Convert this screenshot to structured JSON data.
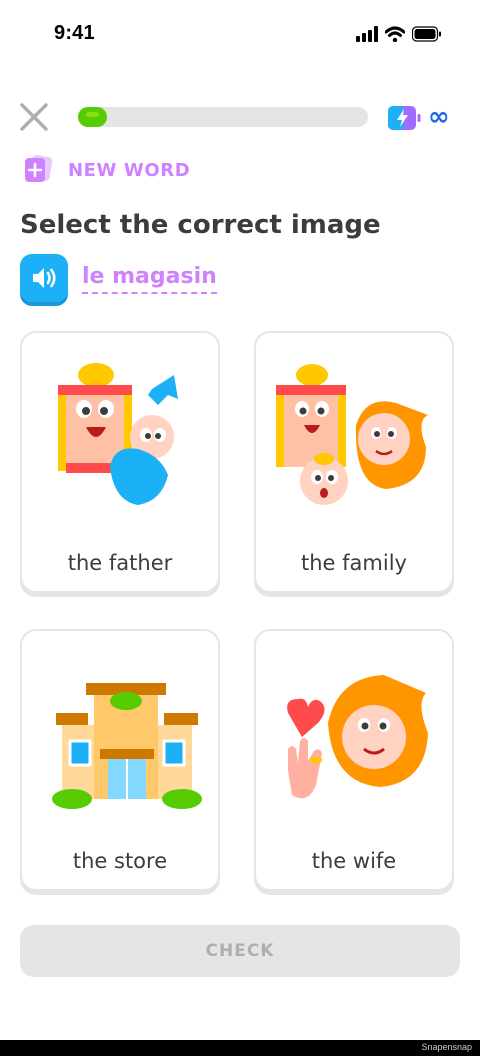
{
  "status_bar": {
    "time": "9:41"
  },
  "top_bar": {
    "progress": 0.1,
    "energy_value": "∞"
  },
  "new_word": {
    "label": "NEW WORD"
  },
  "prompt": {
    "title": "Select the correct image",
    "word": "le magasin"
  },
  "options": [
    {
      "label": "the father"
    },
    {
      "label": "the family"
    },
    {
      "label": "the store"
    },
    {
      "label": "the wife"
    }
  ],
  "check_button": {
    "label": "CHECK",
    "enabled": false
  },
  "watermark": "Snapensnap",
  "colors": {
    "green": "#58cc02",
    "blue": "#1cb0f6",
    "purple": "#ce82ff",
    "border": "#e5e5e5",
    "disabled_text": "#afafaf"
  },
  "icons": [
    "close-icon",
    "energy-icon",
    "infinity-icon",
    "new-word-icon",
    "speaker-icon",
    "signal-icon",
    "wifi-icon",
    "battery-icon"
  ]
}
